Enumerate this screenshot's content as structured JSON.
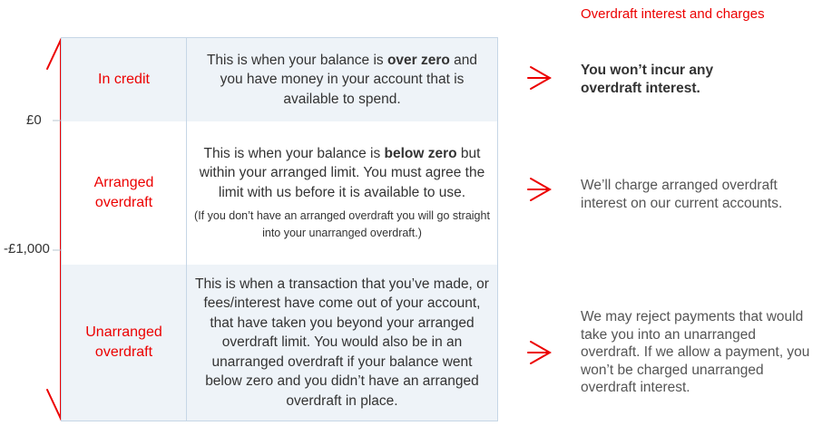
{
  "header": {
    "title": "Overdraft interest and charges"
  },
  "scale": {
    "zero_label": "£0",
    "limit_label": "-£1,000"
  },
  "rows": [
    {
      "label": "In credit",
      "desc_pre": "This is when your balance is ",
      "desc_bold": "over zero",
      "desc_post": " and you have money in your account that is available to spend.",
      "note": "",
      "result": "You won’t incur any overdraft interest."
    },
    {
      "label": "Arranged overdraft",
      "desc_pre": "This is when your balance is ",
      "desc_bold": "below zero",
      "desc_post": " but within your arranged limit. You must agree the limit with us before it is available to use.",
      "note": "(If you don’t have an arranged overdraft you will go straight into your unarranged overdraft.)",
      "result": "We’ll charge arranged overdraft interest on our current accounts."
    },
    {
      "label": "Unarranged overdraft",
      "desc_pre": "This is when a transaction that you’ve made, or fees/interest have come out of your account, that have taken you beyond your arranged overdraft limit. You would also be in an unarranged overdraft if your balance went below zero and you didn’t have an arranged overdraft in place.",
      "desc_bold": "",
      "desc_post": "",
      "note": "",
      "result": "We may reject payments that would take you into an unarranged overdraft. If we allow a payment, you won’t be charged unarranged overdraft interest."
    }
  ],
  "colors": {
    "accent": "#ec0000",
    "shade": "#eef3f8",
    "border": "#c6d6e6"
  }
}
